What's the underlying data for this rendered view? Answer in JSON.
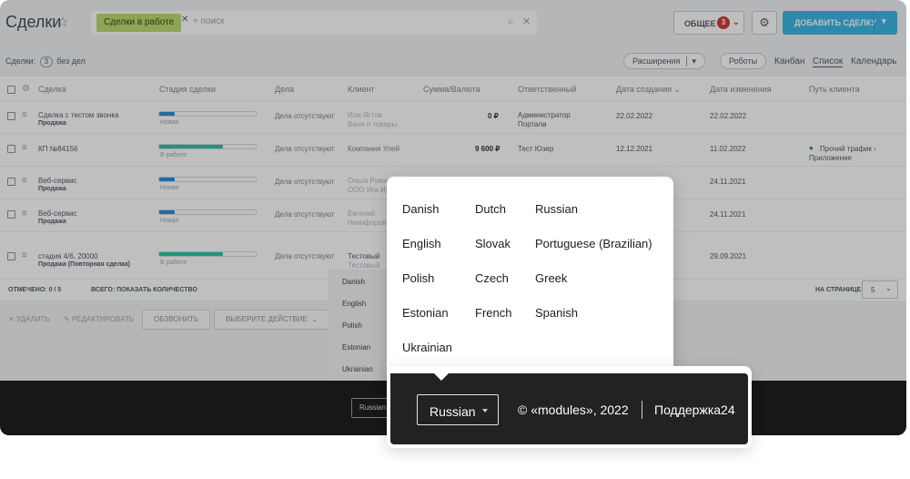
{
  "header": {
    "title": "Сделки",
    "filter_chip": "Сделки в работе",
    "search_placeholder": "+ поиск",
    "general_button": "ОБЩЕЕ",
    "general_badge": "3",
    "add_deal_button": "ДОБАВИТЬ СДЕЛКУ"
  },
  "subbar": {
    "deals_label": "Сделки:",
    "deals_count": "3",
    "deals_suffix": "без дел",
    "extensions": "Расширения",
    "robots": "Роботы",
    "tabs": [
      "Канбан",
      "Список",
      "Календарь"
    ]
  },
  "table": {
    "columns": [
      "Сделка",
      "Стадия сделки",
      "Дела",
      "Клиент",
      "Сумма/Валюта",
      "Ответственный",
      "Дата создания",
      "Дата изменения",
      "Путь клиента"
    ],
    "rows": [
      {
        "deal": "Сделка с тестом звонка",
        "type": "Продажа",
        "stage": "Новая",
        "progress": 0.16,
        "color": "#2f8fd6",
        "activities": "Дела отсутствуют",
        "client": "Иля Ягтов",
        "client2": "Ваня и товары",
        "sum": "0 ₽",
        "owner": "Администратор",
        "owner2": "Портала",
        "created": "22.02.2022",
        "modified": "22.02.2022",
        "path": "",
        "path2": ""
      },
      {
        "deal": "КП №84156",
        "type": "",
        "stage": "В работе",
        "progress": 0.66,
        "color": "#2fc6a2",
        "activities": "Дела отсутствуют",
        "client": "Компания Улей",
        "client2": "",
        "sum": "9 600 ₽",
        "owner": "Тест Юзер",
        "owner2": "",
        "created": "12.12.2021",
        "modified": "11.02.2022",
        "path": "Прочий трафик",
        "path2": "Приложение"
      },
      {
        "deal": "Веб-сервис",
        "type": "Продажа",
        "stage": "Новая",
        "progress": 0.16,
        "color": "#2f8fd6",
        "activities": "Дела отсутствуют",
        "client": "Ольга Романова",
        "client2": "ООО Ига Ири",
        "sum": "",
        "owner": "",
        "owner2": "",
        "created": "",
        "modified": "24.11.2021",
        "path": "",
        "path2": ""
      },
      {
        "deal": "Веб-сервис",
        "type": "Продажа",
        "stage": "Новая",
        "progress": 0.16,
        "color": "#2f8fd6",
        "activities": "Дела отсутствуют",
        "client": "Евгений",
        "client2": "Никифоров",
        "sum": "",
        "owner": "",
        "owner2": "",
        "created": "",
        "modified": "24.11.2021",
        "path": "",
        "path2": ""
      },
      {
        "deal": "стадия 4/6, 20000",
        "type": "Продажа (Повторная сделка)",
        "stage": "В работе",
        "progress": 0.66,
        "color": "#2fc6a2",
        "activities": "Дела отсутствуют",
        "client": "Тестовый",
        "client2": "Тестовый",
        "sum": "",
        "owner": "",
        "owner2": "",
        "created": "",
        "modified": "29.09.2021",
        "path": "",
        "path2": ""
      }
    ]
  },
  "table_footer": {
    "marked": "ОТМЕЧЕНО: 0 / 5",
    "total": "ВСЕГО: ПОКАЗАТЬ КОЛИЧЕСТВО",
    "per_page_label": "НА СТРАНИЦЕ:",
    "per_page_value": "5"
  },
  "actions": {
    "delete": "УДАЛИТЬ",
    "edit": "РЕДАКТИРОВАТЬ",
    "call": "ОБЗВОНИТЬ",
    "choose_action": "ВЫБЕРИТЕ ДЕЙСТВИЕ"
  },
  "small_menu": {
    "items": [
      "Danish",
      "English",
      "Polish",
      "Estonian",
      "Ukrainian"
    ],
    "selected": "Russian"
  },
  "language_popup": {
    "languages": [
      "Danish",
      "Dutch",
      "Russian",
      "English",
      "Slovak",
      "Portuguese (Brazilian)",
      "Polish",
      "Czech",
      "Greek",
      "Estonian",
      "French",
      "Spanish",
      "Ukrainian"
    ]
  },
  "footer": {
    "language_value": "Russian",
    "copyright": "© «modules», 2022",
    "support": "Поддержка24"
  },
  "colors": {
    "accent": "#3bb8e7",
    "chip": "#bcdc71",
    "badge": "#d23d3a",
    "footer_bg": "#222222"
  }
}
